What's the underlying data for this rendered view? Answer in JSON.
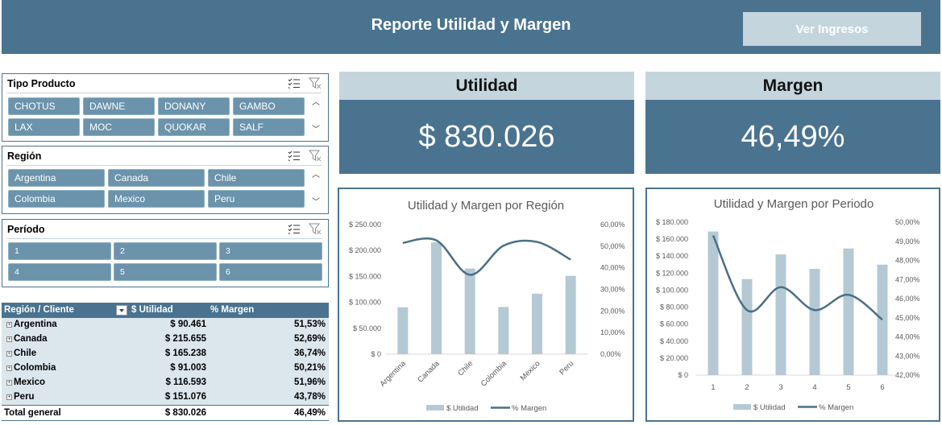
{
  "header": {
    "title": "Reporte Utilidad y Margen",
    "button_label": "Ver Ingresos"
  },
  "slicers": {
    "tipo": {
      "title": "Tipo Producto",
      "items": [
        "CHOTUS",
        "DAWNE",
        "DONANY",
        "GAMBO",
        "LAX",
        "MOC",
        "QUOKAR",
        "SALF"
      ]
    },
    "region": {
      "title": "Región",
      "items": [
        "Argentina",
        "Canada",
        "Chile",
        "Colombia",
        "Mexico",
        "Peru"
      ]
    },
    "periodo": {
      "title": "Período",
      "items": [
        "1",
        "2",
        "3",
        "4",
        "5",
        "6"
      ]
    }
  },
  "kpis": {
    "utilidad": {
      "label": "Utilidad",
      "value": "$ 830.026"
    },
    "margen": {
      "label": "Margen",
      "value": "46,49%"
    }
  },
  "pivot": {
    "headers": [
      "Región / Cliente",
      "$ Utilidad",
      "% Margen"
    ],
    "rows": [
      {
        "region": "Argentina",
        "utilidad": "$ 90.461",
        "margen": "51,53%"
      },
      {
        "region": "Canada",
        "utilidad": "$ 215.655",
        "margen": "52,69%"
      },
      {
        "region": "Chile",
        "utilidad": "$ 165.238",
        "margen": "36,74%"
      },
      {
        "region": "Colombia",
        "utilidad": "$ 91.003",
        "margen": "50,21%"
      },
      {
        "region": "Mexico",
        "utilidad": "$ 116.593",
        "margen": "51,96%"
      },
      {
        "region": "Peru",
        "utilidad": "$ 151.076",
        "margen": "43,78%"
      }
    ],
    "total": {
      "label": "Total general",
      "utilidad": "$ 830.026",
      "margen": "46,49%"
    }
  },
  "colors": {
    "dark": "#4a7390",
    "light": "#c5d5de",
    "chip": "#6b93ab",
    "bar": "#b4c9d3",
    "line": "#4a6f87"
  },
  "chart_data": [
    {
      "type": "bar",
      "title": "Utilidad y Margen por Región",
      "categories": [
        "Argentina",
        "Canada",
        "Chile",
        "Colombia",
        "Mexico",
        "Peru"
      ],
      "series": [
        {
          "name": "$ Utilidad",
          "type": "bar",
          "axis": "left",
          "values": [
            90461,
            215655,
            165238,
            91003,
            116593,
            151076
          ]
        },
        {
          "name": "% Margen",
          "type": "line",
          "axis": "right",
          "values": [
            51.53,
            52.69,
            36.74,
            50.21,
            51.96,
            43.78
          ]
        }
      ],
      "y_left": {
        "min": 0,
        "max": 250000,
        "ticks": [
          "$ 0",
          "$ 50.000",
          "$ 100.000",
          "$ 150.000",
          "$ 200.000",
          "$ 250.000"
        ]
      },
      "y_right": {
        "min": 0,
        "max": 60,
        "ticks": [
          "0,00%",
          "10,00%",
          "20,00%",
          "30,00%",
          "40,00%",
          "50,00%",
          "60,00%"
        ]
      },
      "legend": [
        "$ Utilidad",
        "% Margen"
      ],
      "legend_position": "bottom"
    },
    {
      "type": "bar",
      "title": "Utilidad y Margen por Periodo",
      "categories": [
        "1",
        "2",
        "3",
        "4",
        "5",
        "6"
      ],
      "series": [
        {
          "name": "$ Utilidad",
          "type": "bar",
          "axis": "left",
          "values": [
            169000,
            113000,
            142000,
            125000,
            149000,
            130000
          ]
        },
        {
          "name": "% Margen",
          "type": "line",
          "axis": "right",
          "values": [
            49.3,
            45.4,
            46.6,
            45.4,
            46.2,
            44.9
          ]
        }
      ],
      "y_left": {
        "min": 0,
        "max": 180000,
        "ticks": [
          "$ 0",
          "$ 20.000",
          "$ 40.000",
          "$ 60.000",
          "$ 80.000",
          "$ 100.000",
          "$ 120.000",
          "$ 140.000",
          "$ 160.000",
          "$ 180.000"
        ]
      },
      "y_right": {
        "min": 42,
        "max": 50,
        "ticks": [
          "42,00%",
          "43,00%",
          "44,00%",
          "45,00%",
          "46,00%",
          "47,00%",
          "48,00%",
          "49,00%",
          "50,00%"
        ]
      },
      "legend": [
        "$ Utilidad",
        "% Margen"
      ],
      "legend_position": "bottom"
    }
  ]
}
